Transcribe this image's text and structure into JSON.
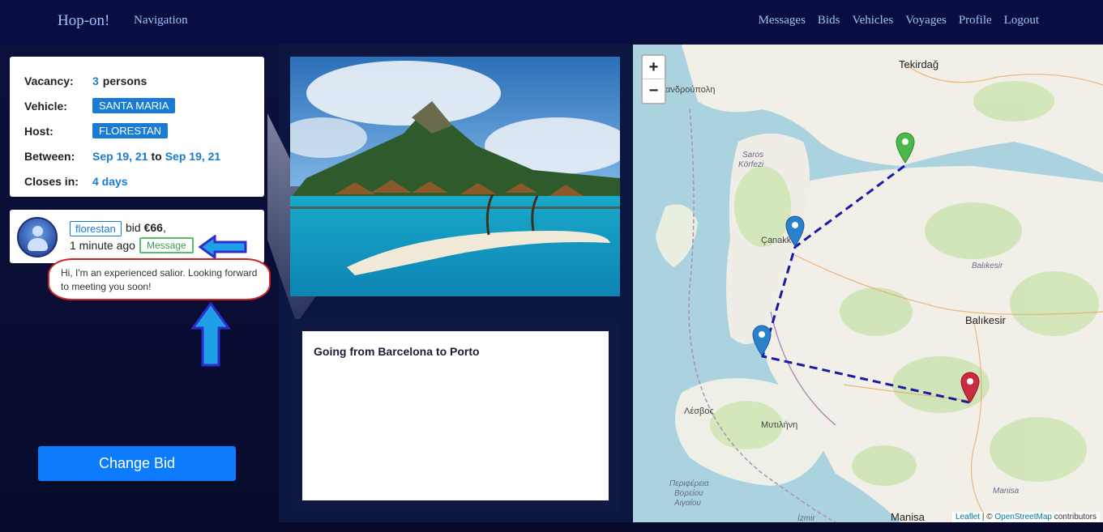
{
  "nav": {
    "brand": "Hop-on!",
    "navigation": "Navigation",
    "links": [
      "Messages",
      "Bids",
      "Vehicles",
      "Voyages",
      "Profile",
      "Logout"
    ]
  },
  "info": {
    "vacancy_label": "Vacancy:",
    "vacancy_count": "3",
    "vacancy_unit": "persons",
    "vehicle_label": "Vehicle:",
    "vehicle_value": "SANTA MARIA",
    "host_label": "Host:",
    "host_value": "FLORESTAN",
    "between_label": "Between:",
    "between_start": "Sep 19, 21",
    "between_to": "to",
    "between_end": "Sep 19, 21",
    "closes_label": "Closes in:",
    "closes_value": "4 days"
  },
  "bid": {
    "bidder": "florestan",
    "bid_word": "bid",
    "amount": "€66",
    "time": "1 minute ago",
    "message_button": "Message",
    "message_text": "Hi, I'm an experienced salior. Looking forward to meeting you soon!"
  },
  "change_bid_label": "Change Bid",
  "voyage": {
    "description": "Going from Barcelona to Porto"
  },
  "map": {
    "zoom_in": "+",
    "zoom_out": "−",
    "labels": {
      "tekirdag": "Tekirdağ",
      "alexandroupoli": "ανδρούπολη",
      "saros": "Saros",
      "korfezi": "Körfezi",
      "canakkale": "Çanakk",
      "balikesir_prov": "Balıkesir",
      "balikesir": "Balıkesir",
      "lesvos": "Λέσβος",
      "mytilini": "Μυτιλήνη",
      "region1": "Περιφέρεια",
      "region2": "Βορείου",
      "region3": "Αιγαίου",
      "manisa_prov": "Manisa",
      "manisa": "Manisa",
      "izmir": "İzmir"
    },
    "attribution_leaflet": "Leaflet",
    "attribution_sep": " | © ",
    "attribution_osm": "OpenStreetMap",
    "attribution_rest": " contributors",
    "marker_colors": {
      "start": "#4cb84c",
      "waypoint": "#2a81cb",
      "end": "#cb2b3e"
    },
    "route_color": "#1a1aa6"
  }
}
